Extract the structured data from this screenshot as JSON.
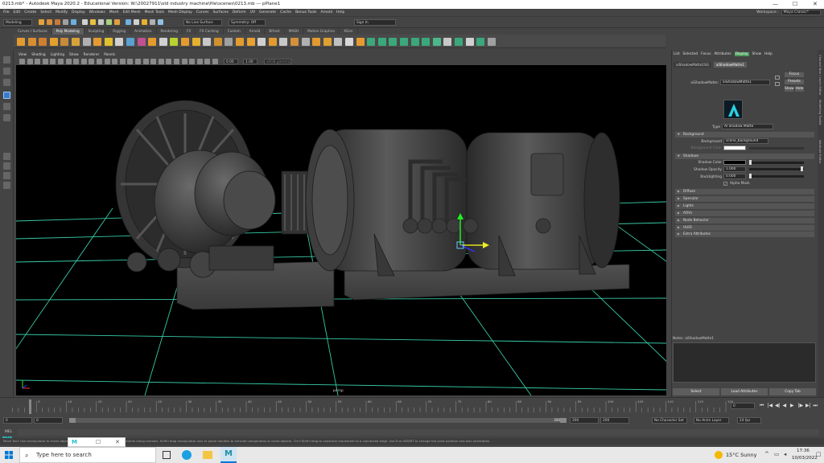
{
  "window": {
    "title": "0213.mb* - Autodesk Maya 2020.2 - Educational Version: W:\\20027911\\old industry machine\\file\\scenes\\0213.mb  ---  pPlane1"
  },
  "menubar": {
    "items": [
      "File",
      "Edit",
      "Create",
      "Select",
      "Modify",
      "Display",
      "Windows",
      "Mesh",
      "Edit Mesh",
      "Mesh Tools",
      "Mesh Display",
      "Curves",
      "Surfaces",
      "Deform",
      "UV",
      "Generate",
      "Cache",
      "Bonus Tools",
      "Arnold",
      "Help"
    ],
    "workspace_label": "Workspace :",
    "workspace_value": "Maya Classic*"
  },
  "statusline": {
    "mode": "Modeling",
    "live_surface": "No Live Surface",
    "symmetry": "Symmetry: Off",
    "signin": "Sign In"
  },
  "shelf": {
    "tabs": [
      "Curves / Surfaces",
      "Poly Modeling",
      "Sculpting",
      "Rigging",
      "Animation",
      "Rendering",
      "FX",
      "FX Caching",
      "Custom",
      "Arnold",
      "Bifrost",
      "MASH",
      "Motion Graphics",
      "XGen"
    ],
    "active": "Poly Modeling"
  },
  "panel": {
    "menus": [
      "View",
      "Shading",
      "Lighting",
      "Show",
      "Renderer",
      "Panels"
    ],
    "near": "0.00",
    "far": "1.00",
    "colorspace": "sRGB gamma",
    "camera": "persp"
  },
  "attribute_editor": {
    "menus": [
      "List",
      "Selected",
      "Focus",
      "Attributes",
      "Display",
      "Show",
      "Help"
    ],
    "highlight_menu": "Display",
    "tabs": [
      "aiShadowMatte1SG",
      "aiShadowMatte1"
    ],
    "active_tab": "aiShadowMatte1",
    "node_label": "aiShadowMatte:",
    "node_name": "aiShadowMatte1",
    "buttons": {
      "focus": "Focus",
      "presets": "Presets",
      "show": "Show",
      "hide": "Hide"
    },
    "type_label": "Type",
    "type_value": "AI Shadow Matte",
    "sections": {
      "background": "Background",
      "shadows": "Shadows",
      "collapsed": [
        "Diffuse",
        "Specular",
        "Lights",
        "AOVs",
        "Node Behavior",
        "UUID",
        "Extra Attributes"
      ]
    },
    "background_label": "Background",
    "background_value": "scene_background",
    "background_color_label": "Background Color",
    "shadow_color_label": "Shadow Color",
    "shadow_opacity_label": "Shadow Opacity",
    "shadow_opacity_value": "1.000",
    "backlighting_label": "Backlighting",
    "backlighting_value": "0.000",
    "alpha_mask_label": "Alpha Mask",
    "alpha_mask_checked": true,
    "notes_label": "Notes: aiShadowMatte1",
    "bottom_buttons": [
      "Select",
      "Load Attributes",
      "Copy Tab"
    ]
  },
  "side_tabs": [
    "Channel Box / Layer Editor",
    "Modelling Toolkit",
    "Attribute Editor"
  ],
  "timeline": {
    "ticks": [
      "5",
      "10",
      "15",
      "20",
      "25",
      "30",
      "35",
      "40",
      "45",
      "50",
      "55",
      "60",
      "65",
      "70",
      "75",
      "80",
      "85",
      "90",
      "95",
      "100",
      "105",
      "110",
      "115",
      "120"
    ],
    "current": "0",
    "range_start": "0",
    "range_inner_start": "0",
    "range_inner_end": "200",
    "range_end_a": "200",
    "range_end_b": "200",
    "character_set": "No Character Set",
    "anim_layer": "No Anim Layer",
    "fps": "24 fps"
  },
  "mel": {
    "label": "MEL"
  },
  "helpline": "Move Tool: Use manipulator to move object(s). Ctrl+middle-drag to move components along normals. Shift+drag manipulator axis or plane handles to extrude components or clone objects. Ctrl+Shift+drag to constrain movement to a connected edge. Use D or INSERT to change the pivot position and axis orientation.",
  "taskbar": {
    "search_placeholder": "Type here to search",
    "weather": "15°C  Sunny",
    "time": "17:36",
    "date": "10/03/2022"
  },
  "colors": {
    "grid": "#37c9a6",
    "ui_bg": "#444444",
    "accent": "#26c0c8",
    "display_highlight": "#4a9b5a"
  }
}
